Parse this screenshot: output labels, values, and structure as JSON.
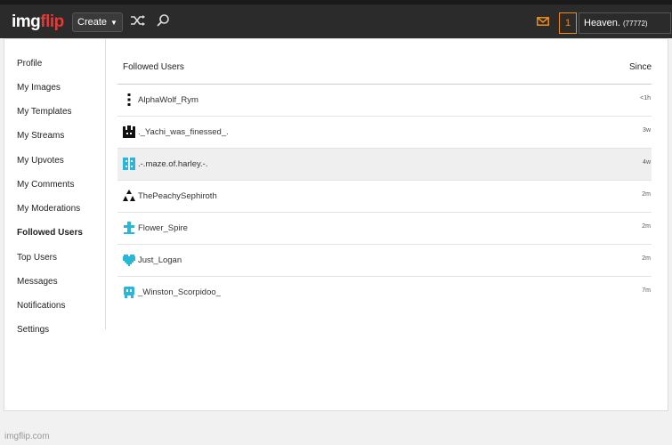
{
  "header": {
    "logo_part1": "img",
    "logo_part2": "flip",
    "create_label": "Create",
    "notification_count": "1",
    "username": "Heaven.",
    "user_points": "(77772)",
    "accent_color": "#f08c1a",
    "logo_red": "#e53935"
  },
  "sidebar": {
    "items": [
      {
        "label": "Profile",
        "active": false
      },
      {
        "label": "My Images",
        "active": false
      },
      {
        "label": "My Templates",
        "active": false
      },
      {
        "label": "My Streams",
        "active": false
      },
      {
        "label": "My Upvotes",
        "active": false
      },
      {
        "label": "My Comments",
        "active": false
      },
      {
        "label": "My Moderations",
        "active": false
      },
      {
        "label": "Followed Users",
        "active": true
      },
      {
        "label": "Top Users",
        "active": false
      },
      {
        "label": "Messages",
        "active": false
      },
      {
        "label": "Notifications",
        "active": false
      },
      {
        "label": "Settings",
        "active": false
      }
    ]
  },
  "table": {
    "col_user": "Followed Users",
    "col_since": "Since",
    "rows": [
      {
        "name": "AlphaWolf_Rym",
        "since": "<1h",
        "icon": "vertical-dots-icon",
        "color": "#111111"
      },
      {
        "name": "._Yachi_was_finessed_.",
        "since": "3w",
        "icon": "pixel-castle-icon",
        "color": "#111111"
      },
      {
        "name": ".-.maze.of.harley.-.",
        "since": "4w",
        "icon": "pixel-grid-icon",
        "color": "#29b6d8"
      },
      {
        "name": "ThePeachySephiroth",
        "since": "2m",
        "icon": "triangles-icon",
        "color": "#111111"
      },
      {
        "name": "Flower_Spire",
        "since": "2m",
        "icon": "cross-icon",
        "color": "#29b6d8"
      },
      {
        "name": "Just_Logan",
        "since": "2m",
        "icon": "pixel-heart-icon",
        "color": "#29b6d8"
      },
      {
        "name": "_Winston_Scorpidoo_",
        "since": "7m",
        "icon": "pixel-face-icon",
        "color": "#29b6d8"
      }
    ]
  },
  "footer": {
    "text": "imgflip.com"
  }
}
